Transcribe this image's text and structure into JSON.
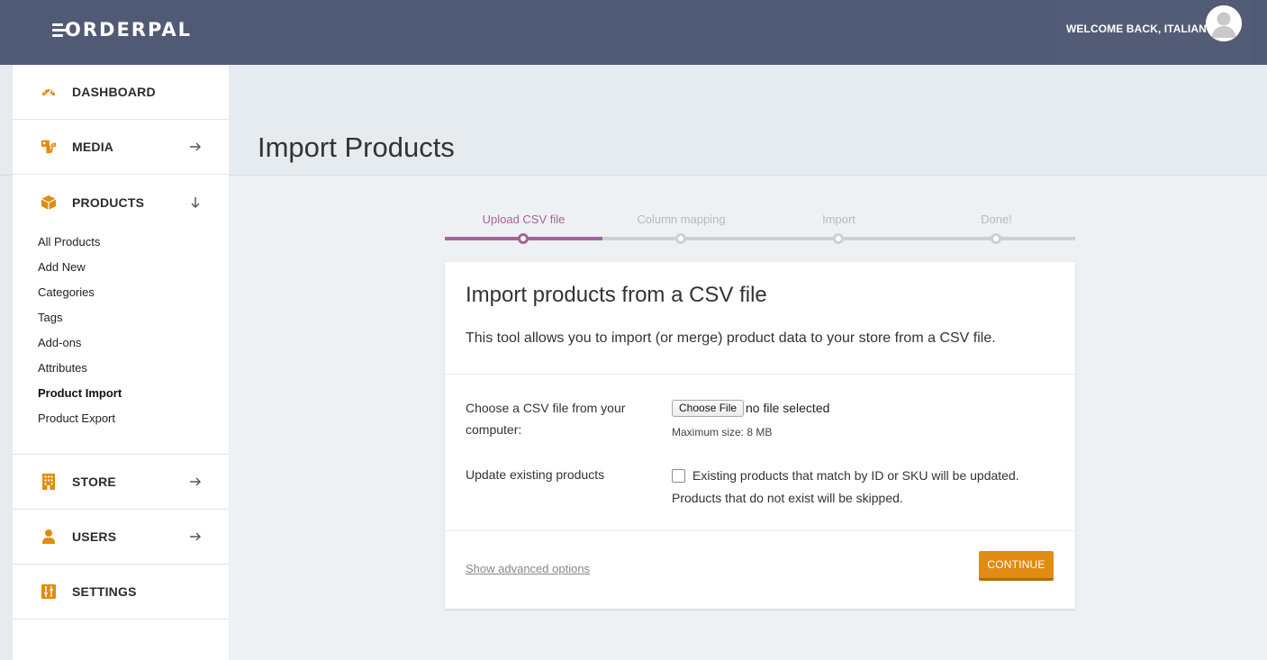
{
  "brand": {
    "logo_text": "ORDERPAL",
    "accent_color": "#e28b12",
    "topbar_color": "#515a75",
    "step_color": "#a46497"
  },
  "header": {
    "welcome_text": "WELCOME BACK, ITALIAN"
  },
  "sidebar": {
    "dashboard": {
      "label": "DASHBOARD",
      "icon": "speedometer-icon"
    },
    "media": {
      "label": "MEDIA",
      "icon": "media-icon"
    },
    "products": {
      "label": "PRODUCTS",
      "icon": "box-icon",
      "sub": [
        "All Products",
        "Add New",
        "Categories",
        "Tags",
        "Add-ons",
        "Attributes",
        "Product Import",
        "Product Export"
      ],
      "active_sub": "Product Import"
    },
    "store": {
      "label": "STORE",
      "icon": "building-icon"
    },
    "users": {
      "label": "USERS",
      "icon": "user-icon"
    },
    "settings": {
      "label": "SETTINGS",
      "icon": "settings-icon"
    }
  },
  "page": {
    "title": "Import Products"
  },
  "steps": [
    "Upload CSV file",
    "Column mapping",
    "Import",
    "Done!"
  ],
  "active_step": 0,
  "card": {
    "title": "Import products from a CSV file",
    "description": "This tool allows you to import (or merge) product data to your store from a CSV file.",
    "file_label": "Choose a CSV file from your computer:",
    "file_button": "Choose File",
    "file_status": "no file selected",
    "max_size": "Maximum size: 8 MB",
    "update_label": "Update existing products",
    "update_checked": false,
    "update_text1": "Existing products that match by ID or SKU will be updated.",
    "update_text2": "Products that do not exist will be skipped.",
    "advanced_link": "Show advanced options",
    "continue_button": "CONTINUE"
  }
}
